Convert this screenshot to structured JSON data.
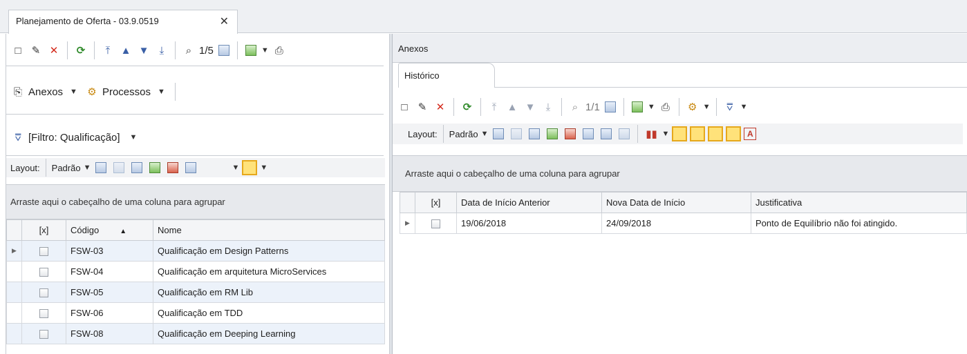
{
  "document_tab": {
    "title": "Planejamento de Oferta - 03.9.0519",
    "close": "✕"
  },
  "left": {
    "toolbar1": {
      "record_counter": "1/5"
    },
    "toolbar2": {
      "anexos": "Anexos",
      "processos": "Processos"
    },
    "filter": {
      "label": "[Filtro: Qualificação]"
    },
    "layout": {
      "label": "Layout:",
      "preset": "Padrão"
    },
    "group_hint": "Arraste aqui o cabeçalho de uma coluna para agrupar",
    "grid": {
      "columns": [
        "[x]",
        "Código",
        "Nome"
      ],
      "rows": [
        {
          "codigo": "FSW-03",
          "nome": "Qualificação em Design Patterns"
        },
        {
          "codigo": "FSW-04",
          "nome": "Qualificação em arquitetura MicroServices"
        },
        {
          "codigo": "FSW-05",
          "nome": "Qualificação em RM Lib"
        },
        {
          "codigo": "FSW-06",
          "nome": "Qualificação em TDD"
        },
        {
          "codigo": "FSW-08",
          "nome": "Qualificação em Deeping Learning"
        }
      ]
    }
  },
  "right": {
    "panel_title": "Anexos",
    "tab": "Histórico",
    "toolbar": {
      "record_counter": "1/1"
    },
    "layout": {
      "label": "Layout:",
      "preset": "Padrão"
    },
    "group_hint": "Arraste aqui o cabeçalho de uma coluna para agrupar",
    "grid": {
      "columns": [
        "[x]",
        "Data de Início Anterior",
        "Nova Data de Início",
        "Justificativa"
      ],
      "rows": [
        {
          "anterior": "19/06/2018",
          "nova": "24/09/2018",
          "justificativa": "Ponto de Equilíbrio não foi atingido."
        }
      ]
    }
  },
  "colors": {
    "accent": "#e6a81c",
    "selected_row": "#ecf2fa",
    "group_area": "#e7e9ed"
  }
}
